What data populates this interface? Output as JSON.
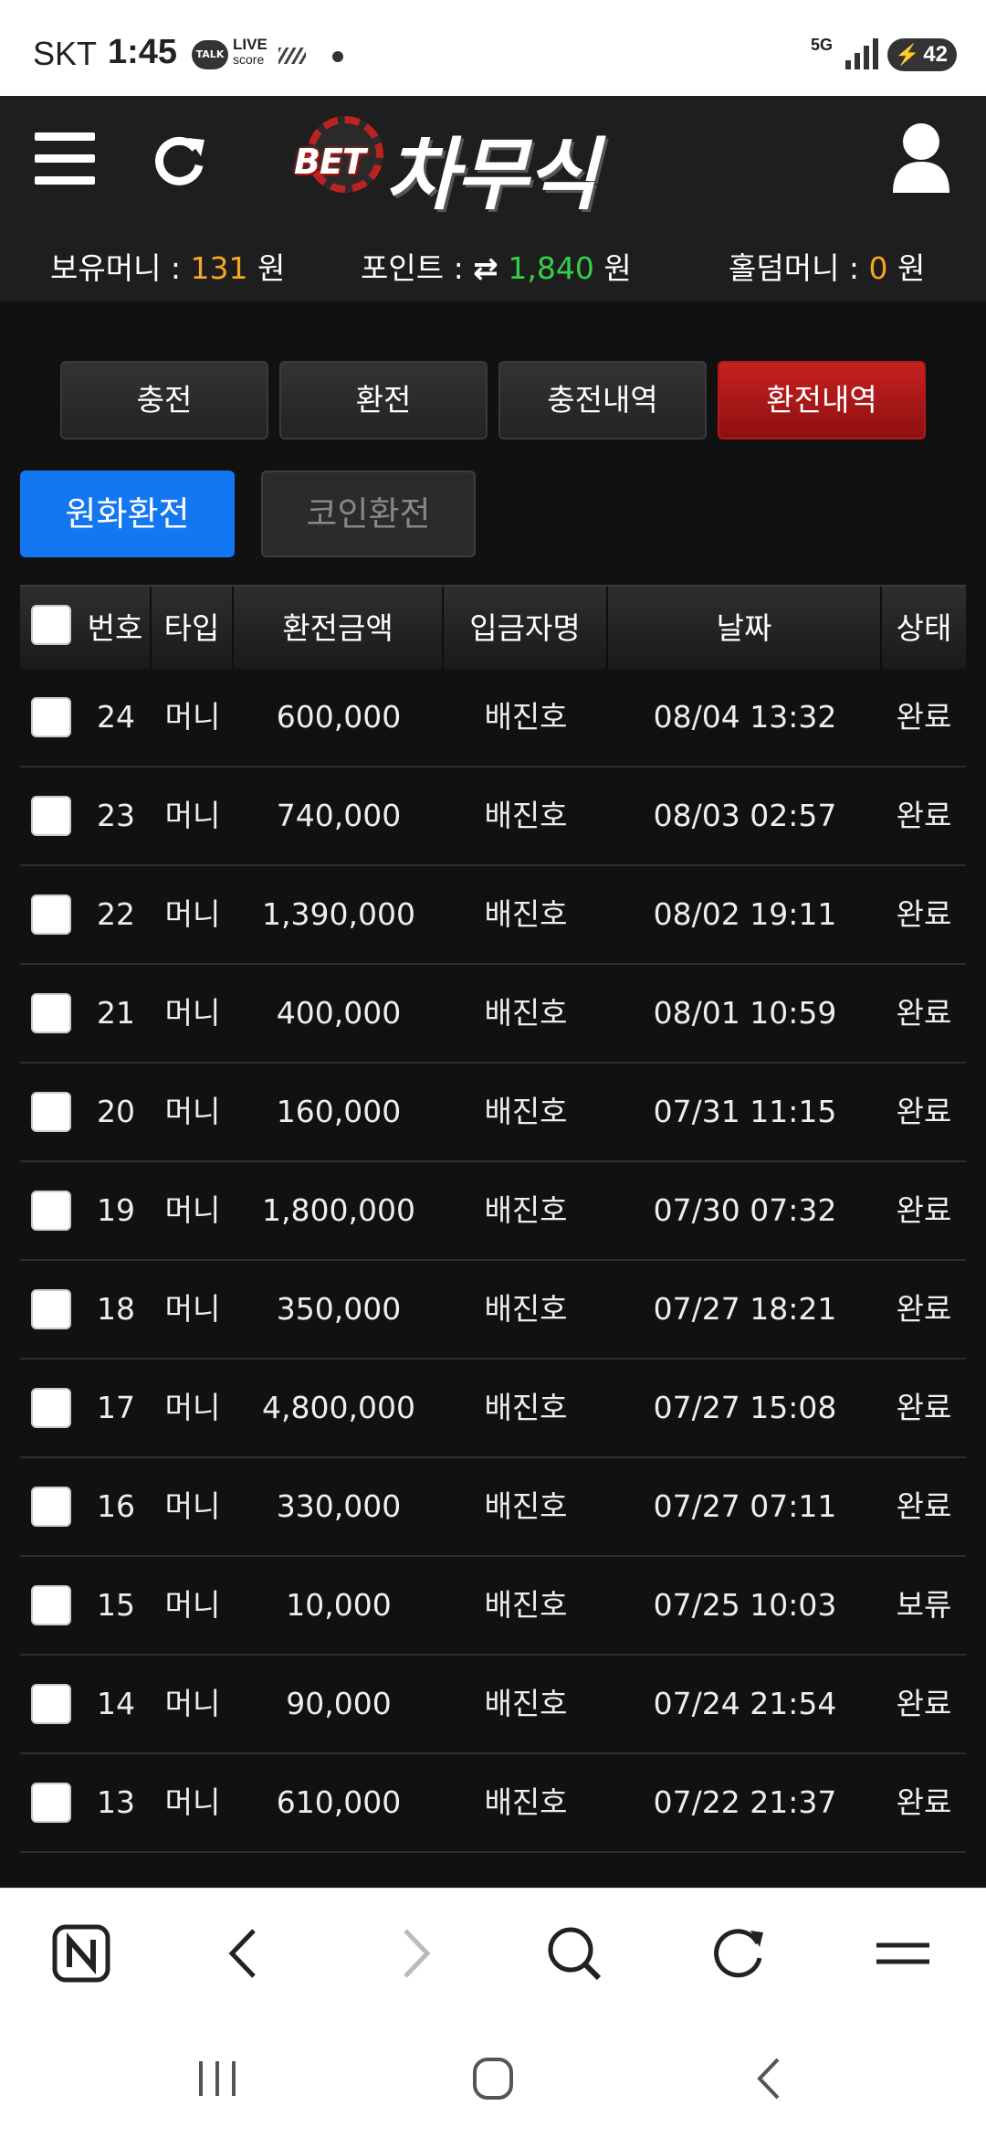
{
  "status_bar": {
    "carrier": "SKT",
    "time": "1:45",
    "talk_badge": "TALK",
    "live_label": "LIVE",
    "score_label": "score",
    "network": "5G",
    "battery": "42"
  },
  "header": {
    "logo_prefix": "BET",
    "logo_title": "차무식",
    "balances": {
      "money_label": "보유머니 : ",
      "money_value": "131",
      "money_unit": " 원",
      "point_label": "포인트 : ",
      "point_value": "1,840",
      "point_unit": " 원",
      "holdem_label": "홀덤머니 : ",
      "holdem_value": "0",
      "holdem_unit": " 원"
    }
  },
  "tabs": [
    "충전",
    "환전",
    "충전내역",
    "환전내역"
  ],
  "active_tab": "환전내역",
  "subtabs": {
    "krw": "원화환전",
    "coin": "코인환전"
  },
  "table": {
    "columns": [
      "번호",
      "타입",
      "환전금액",
      "입금자명",
      "날짜",
      "상태"
    ],
    "rows": [
      {
        "no": "24",
        "type": "머니",
        "amount": "600,000",
        "name": "배진호",
        "date": "08/04 13:32",
        "status": "완료"
      },
      {
        "no": "23",
        "type": "머니",
        "amount": "740,000",
        "name": "배진호",
        "date": "08/03 02:57",
        "status": "완료"
      },
      {
        "no": "22",
        "type": "머니",
        "amount": "1,390,000",
        "name": "배진호",
        "date": "08/02 19:11",
        "status": "완료"
      },
      {
        "no": "21",
        "type": "머니",
        "amount": "400,000",
        "name": "배진호",
        "date": "08/01 10:59",
        "status": "완료"
      },
      {
        "no": "20",
        "type": "머니",
        "amount": "160,000",
        "name": "배진호",
        "date": "07/31 11:15",
        "status": "완료"
      },
      {
        "no": "19",
        "type": "머니",
        "amount": "1,800,000",
        "name": "배진호",
        "date": "07/30 07:32",
        "status": "완료"
      },
      {
        "no": "18",
        "type": "머니",
        "amount": "350,000",
        "name": "배진호",
        "date": "07/27 18:21",
        "status": "완료"
      },
      {
        "no": "17",
        "type": "머니",
        "amount": "4,800,000",
        "name": "배진호",
        "date": "07/27 15:08",
        "status": "완료"
      },
      {
        "no": "16",
        "type": "머니",
        "amount": "330,000",
        "name": "배진호",
        "date": "07/27 07:11",
        "status": "완료"
      },
      {
        "no": "15",
        "type": "머니",
        "amount": "10,000",
        "name": "배진호",
        "date": "07/25 10:03",
        "status": "보류"
      },
      {
        "no": "14",
        "type": "머니",
        "amount": "90,000",
        "name": "배진호",
        "date": "07/24 21:54",
        "status": "완료"
      },
      {
        "no": "13",
        "type": "머니",
        "amount": "610,000",
        "name": "배진호",
        "date": "07/22 21:37",
        "status": "완료"
      }
    ]
  },
  "browser_bar": {
    "icons": [
      "naver-home-icon",
      "back-icon",
      "forward-icon",
      "search-icon",
      "reload-icon",
      "menu-icon"
    ]
  },
  "colors": {
    "accent_red": "#c62121",
    "accent_blue": "#1477f2",
    "money_orange": "#f5a623",
    "point_green": "#33d04a"
  }
}
